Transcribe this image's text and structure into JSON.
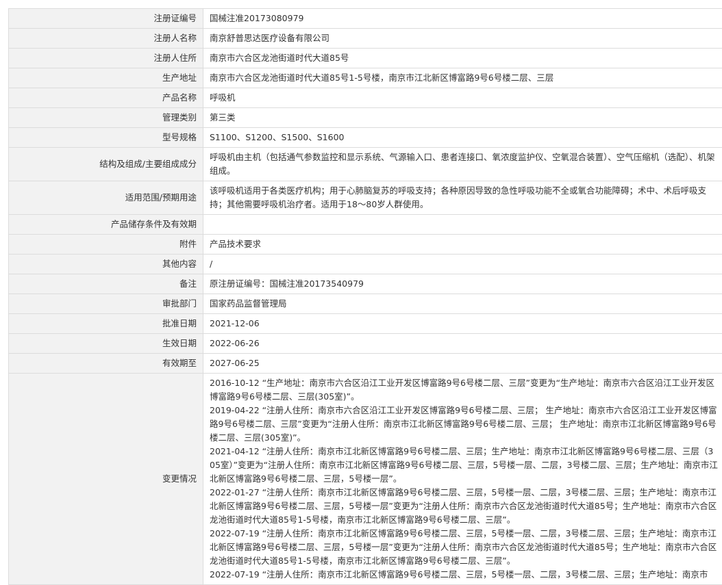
{
  "rows": [
    {
      "label": "注册证编号",
      "value": "国械注准20173080979"
    },
    {
      "label": "注册人名称",
      "value": "南京舒普思达医疗设备有限公司"
    },
    {
      "label": "注册人住所",
      "value": "南京市六合区龙池街道时代大道85号"
    },
    {
      "label": "生产地址",
      "value": "南京市六合区龙池街道时代大道85号1-5号楼，南京市江北新区博富路9号6号楼二层、三层"
    },
    {
      "label": "产品名称",
      "value": "呼吸机"
    },
    {
      "label": "管理类别",
      "value": "第三类"
    },
    {
      "label": "型号规格",
      "value": "S1100、S1200、S1500、S1600"
    },
    {
      "label": "结构及组成/主要组成成分",
      "value": "呼吸机由主机（包括通气参数监控和显示系统、气源输入口、患者连接口、氧浓度监护仪、空氧混合装置）、空气压缩机（选配）、机架组成。"
    },
    {
      "label": "适用范围/预期用途",
      "value": "该呼吸机适用于各类医疗机构；用于心肺脑复苏的呼吸支持；各种原因导致的急性呼吸功能不全或氧合功能障碍；术中、术后呼吸支持；其他需要呼吸机治疗者。适用于18～80岁人群使用。"
    },
    {
      "label": "产品储存条件及有效期",
      "value": ""
    },
    {
      "label": "附件",
      "value": "产品技术要求"
    },
    {
      "label": "其他内容",
      "value": "/"
    },
    {
      "label": "备注",
      "value": "原注册证编号：国械注准20173540979"
    },
    {
      "label": "审批部门",
      "value": "国家药品监督管理局"
    },
    {
      "label": "批准日期",
      "value": "2021-12-06"
    },
    {
      "label": "生效日期",
      "value": "2022-06-26"
    },
    {
      "label": "有效期至",
      "value": "2027-06-25"
    }
  ],
  "changes": {
    "label": "变更情况",
    "entries": [
      "2016-10-12 “生产地址：南京市六合区沿江工业开发区博富路9号6号楼二层、三层”变更为“生产地址：南京市六合区沿江工业开发区博富路9号6号楼二层、三层(305室)”。",
      "2019-04-22 “注册人住所：南京市六合区沿江工业开发区博富路9号6号楼二层、三层； 生产地址：南京市六合区沿江工业开发区博富路9号6号楼二层、三层”变更为“注册人住所：南京市江北新区博富路9号6号楼二层、三层； 生产地址：南京市江北新区博富路9号6号楼二层、三层(305室)”。",
      "2021-04-12 “注册人住所：南京市江北新区博富路9号6号楼二层、三层；生产地址：南京市江北新区博富路9号6号楼二层、三层（305室）”变更为“注册人住所：南京市江北新区博富路9号6号楼二层、三层，5号楼一层、二层，3号楼二层、三层；生产地址：南京市江北新区博富路9号6号楼二层、三层，5号楼一层”。",
      "2022-01-27 “注册人住所：南京市江北新区博富路9号6号楼二层、三层，5号楼一层、二层，3号楼二层、三层；生产地址：南京市江北新区博富路9号6号楼二层、三层，5号楼一层”变更为“注册人住所：南京市六合区龙池街道时代大道85号；生产地址：南京市六合区龙池街道时代大道85号1-5号楼，南京市江北新区博富路9号6号楼二层、三层”。",
      "2022-07-19 “注册人住所：南京市江北新区博富路9号6号楼二层、三层，5号楼一层、二层，3号楼二层、三层；生产地址：南京市江北新区博富路9号6号楼二层、三层，5号楼一层”变更为“注册人住所：南京市六合区龙池街道时代大道85号；生产地址：南京市六合区龙池街道时代大道85号1-5号楼，南京市江北新区博富路9号6号楼二层、三层”。",
      "2022-07-19 “注册人住所：南京市江北新区博富路9号6号楼二层、三层，5号楼一层、二层，3号楼二层、三层；生产地址：南京市"
    ]
  }
}
